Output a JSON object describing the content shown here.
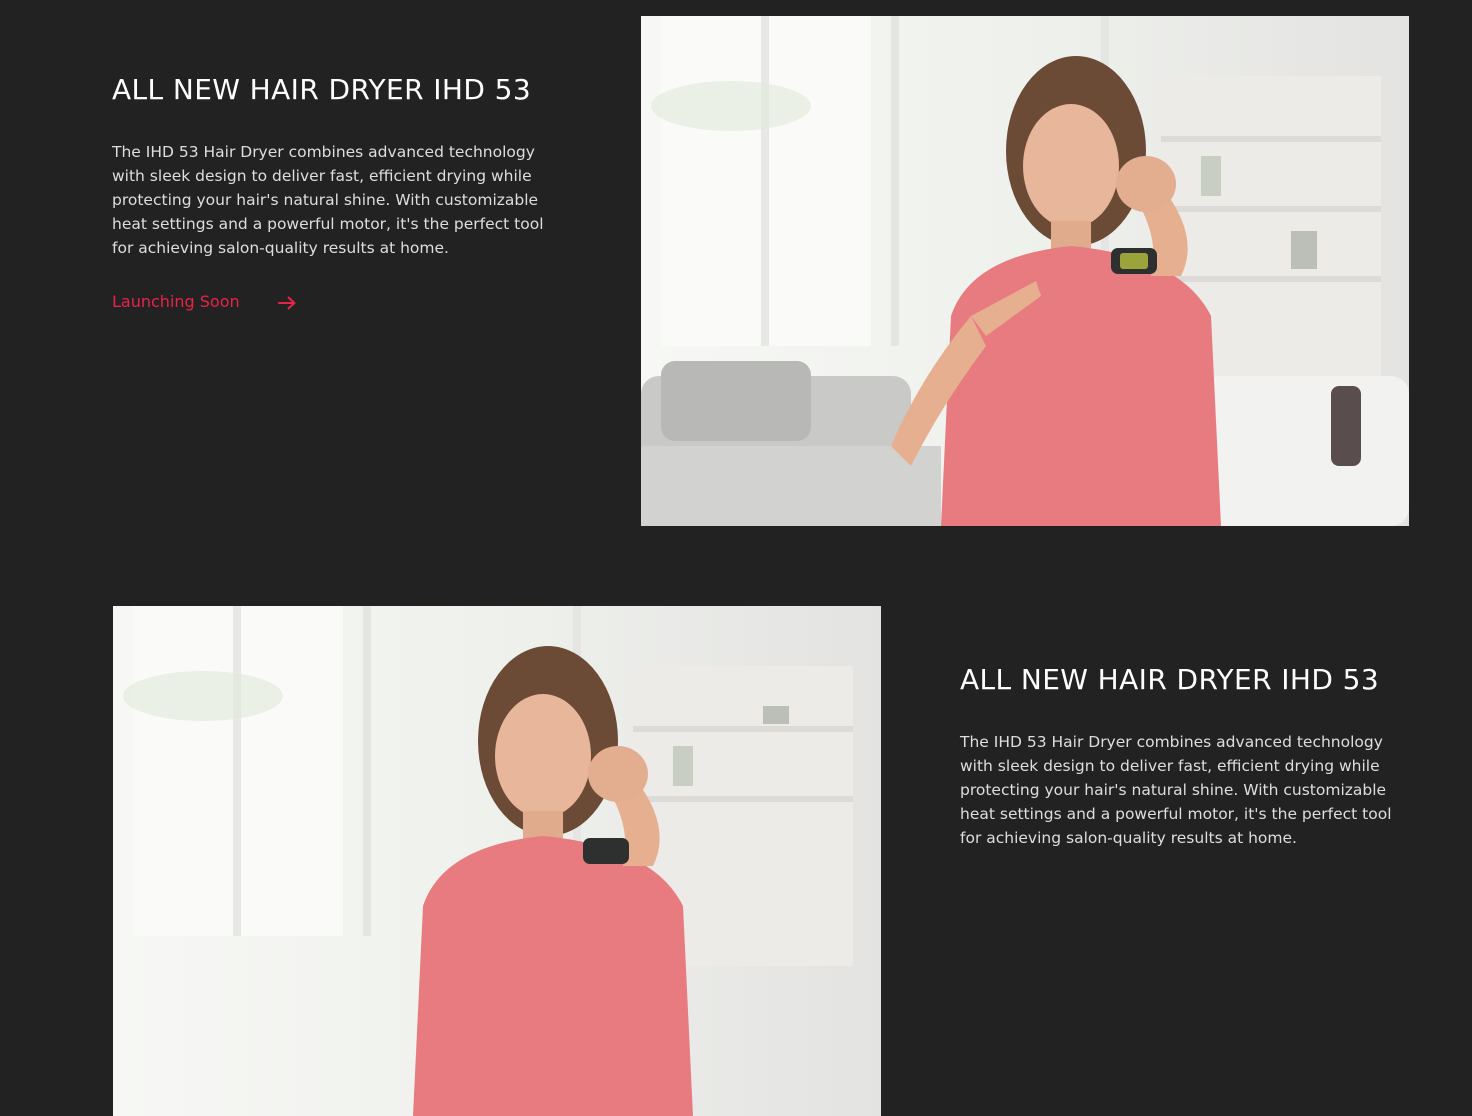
{
  "features": [
    {
      "title": "ALL NEW HAIR DRYER IHD 53",
      "description": "The IHD 53 Hair Dryer combines advanced technology with sleek design to deliver fast, efficient drying while protecting your hair's natural shine. With customizable heat settings and a powerful motor, it's the perfect tool for achieving salon-quality results at home.",
      "cta_label": "Launching Soon",
      "cta_icon": "arrow-right-icon",
      "image_icon": "product-photo"
    },
    {
      "title": "ALL NEW HAIR DRYER IHD 53",
      "description": "The IHD 53 Hair Dryer combines advanced technology with sleek design to deliver fast, efficient drying while protecting your hair's natural shine. With customizable heat settings and a powerful motor, it's the perfect tool for achieving salon-quality results at home.",
      "image_icon": "product-photo"
    }
  ],
  "colors": {
    "background": "#222222",
    "accent": "#e8234a",
    "heading": "#ffffff",
    "body_text": "#dedede"
  }
}
